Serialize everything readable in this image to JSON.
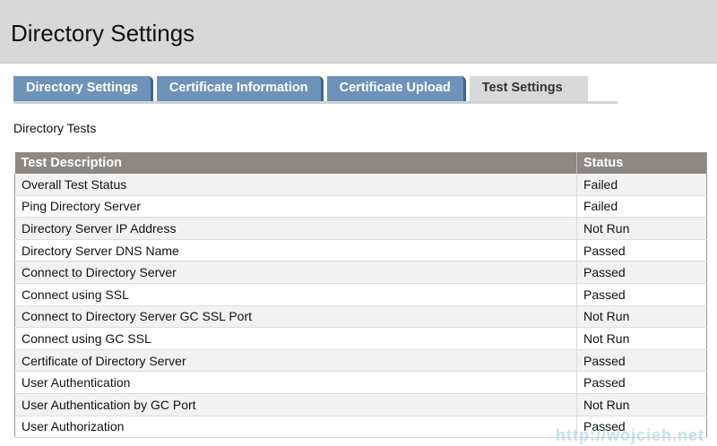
{
  "header": {
    "title": "Directory Settings"
  },
  "tabs": [
    {
      "label": "Directory Settings"
    },
    {
      "label": "Certificate Information"
    },
    {
      "label": "Certificate Upload"
    },
    {
      "label": "Test Settings",
      "active": true
    }
  ],
  "section_title": "Directory Tests",
  "table": {
    "columns": [
      "Test Description",
      "Status"
    ],
    "rows": [
      [
        "Overall Test Status",
        "Failed"
      ],
      [
        "Ping Directory Server",
        "Failed"
      ],
      [
        "Directory Server IP Address",
        "Not Run"
      ],
      [
        "Directory Server DNS Name",
        "Passed"
      ],
      [
        "Connect to Directory Server",
        "Passed"
      ],
      [
        "Connect using SSL",
        "Passed"
      ],
      [
        "Connect to Directory Server GC SSL Port",
        "Not Run"
      ],
      [
        "Connect using GC SSL",
        "Not Run"
      ],
      [
        "Certificate of Directory Server",
        "Passed"
      ],
      [
        "User Authentication",
        "Passed"
      ],
      [
        "User Authentication by GC Port",
        "Not Run"
      ],
      [
        "User Authorization",
        "Passed"
      ]
    ]
  },
  "watermark": "http://wojcieh.net"
}
